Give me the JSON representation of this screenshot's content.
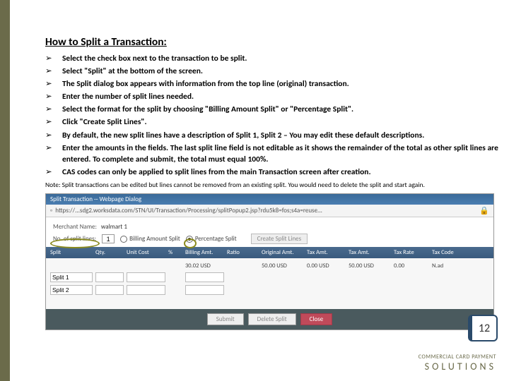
{
  "title": "How to Split a Transaction:",
  "steps": [
    "Select the check box next to the transaction to be split.",
    "Select \"Split\" at the bottom of the screen.",
    "The Split dialog box appears with information from the top line (original) transaction.",
    "Enter the number of split lines needed.",
    "Select the format for the split by choosing \"Billing Amount Split\" or \"Percentage Split\".",
    "Click \"Create Split Lines\".",
    "By default, the new split lines have a description of Split 1, Split 2 – You may edit these default descriptions.",
    "Enter the amounts in the fields. The last split line field is not editable as it shows the remainder of the total as other split lines are entered. To complete and submit, the total must equal 100%.",
    "CAS codes can only be applied to split lines from the main Transaction screen after creation."
  ],
  "note": "Note: Split transactions can be edited but lines cannot be removed from an existing split. You would need to delete the split and start again.",
  "dialog": {
    "title": "Split Transaction -- Webpage Dialog",
    "url": "https://...sdg2.worksdata.com/STN/UI/Transaction/Processing/splitPopup2.jsp?rdu5k8=fos;s4a=reuse...",
    "merchant_label": "Merchant Name:",
    "merchant_value": "walmart 1",
    "nlines_label": "No. of split lines:",
    "nlines_value": "1",
    "radio_billing": "Billing Amount Split",
    "radio_percent": "Percentage Split",
    "create_btn": "Create Split Lines",
    "cols": [
      "Split",
      "Qty.",
      "Unit Cost",
      "%",
      "Billing Amt.",
      "Ratio",
      "Original Amt.",
      "Tax Amt.",
      "Tax Amt.",
      "Tax Rate",
      "Tax Code"
    ],
    "row0": {
      "split": "",
      "qty": "",
      "unitcost": "",
      "pct": "",
      "billing": "30.02 USD",
      "ratio": "",
      "orig": "50.00 USD",
      "tax1": "0.00 USD",
      "tax2": "50.00 USD",
      "rate": "0.00",
      "code": "N.ad"
    },
    "rows": [
      {
        "split": "Split 1",
        "billing": ""
      },
      {
        "split": "Split 2",
        "billing": ""
      }
    ],
    "buttons": {
      "submit": "Submit",
      "delete": "Delete Split",
      "close": "Close"
    }
  },
  "page_number": "12",
  "brand": {
    "small": "COMMERCIAL CARD PAYMENT",
    "big": "SOLUTIONS"
  }
}
